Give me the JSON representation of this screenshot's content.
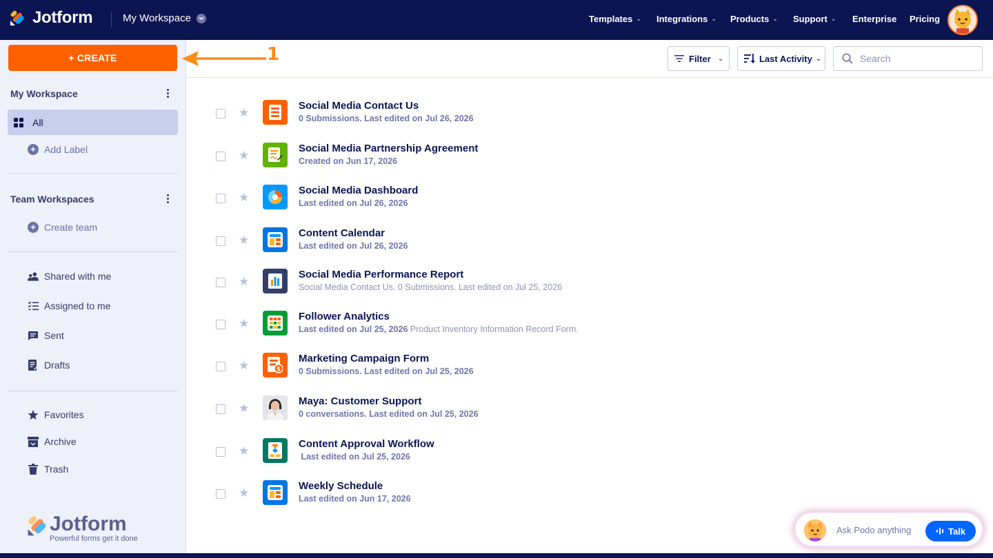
{
  "header": {
    "brand": "Jotform",
    "workspace": "My Workspace",
    "nav": [
      {
        "label": "Templates",
        "has_menu": true
      },
      {
        "label": "Integrations",
        "has_menu": true
      },
      {
        "label": "Products",
        "has_menu": true
      },
      {
        "label": "Support",
        "has_menu": true
      },
      {
        "label": "Enterprise",
        "has_menu": false
      },
      {
        "label": "Pricing",
        "has_menu": false
      }
    ]
  },
  "sidebar": {
    "create_label": "+ CREATE",
    "my_workspace": "My Workspace",
    "all_label": "All",
    "add_label": "Add Label",
    "team_workspaces": "Team Workspaces",
    "create_team": "Create team",
    "links": [
      {
        "label": "Shared with me",
        "icon": "people-icon"
      },
      {
        "label": "Assigned to me",
        "icon": "checklist-icon"
      },
      {
        "label": "Sent",
        "icon": "chat-icon"
      },
      {
        "label": "Drafts",
        "icon": "draft-icon"
      }
    ],
    "links2": [
      {
        "label": "Favorites",
        "icon": "star-icon"
      },
      {
        "label": "Archive",
        "icon": "archive-icon"
      },
      {
        "label": "Trash",
        "icon": "trash-icon"
      }
    ],
    "footer_brand": "Jotform",
    "footer_tagline": "Powerful forms get it done"
  },
  "toolbar": {
    "filter_label": "Filter",
    "sort_label": "Last Activity",
    "search_placeholder": "Search"
  },
  "annotation": {
    "number": "1"
  },
  "items": [
    {
      "title": "Social Media Contact Us",
      "subtitle": "0 Submissions. Last edited on Jul 26, 2026",
      "extra": "",
      "icon": "form-icon",
      "color": "#ff6100"
    },
    {
      "title": "Social Media Partnership Agreement",
      "subtitle": "Created on Jun 17, 2026",
      "extra": "",
      "icon": "sign-icon",
      "color": "#64b200"
    },
    {
      "title": "Social Media Dashboard",
      "subtitle": "Last edited on Jul 26, 2026",
      "extra": "",
      "icon": "report-icon",
      "color": "#0099ff"
    },
    {
      "title": "Content Calendar",
      "subtitle": "Last edited on Jul 26, 2026",
      "extra": "",
      "icon": "app-icon",
      "color": "#0075e3"
    },
    {
      "title": "Social Media Performance Report",
      "subtitle": "",
      "extra": "Social Media Contact Us. 0 Submissions. Last edited on Jul 25, 2026",
      "icon": "bar-report-icon",
      "color": "#344067"
    },
    {
      "title": "Follower Analytics",
      "subtitle": "Last edited on Jul 25, 2026",
      "extra": " Product Inventory Information Record Form.",
      "icon": "table-icon",
      "color": "#049e38"
    },
    {
      "title": "Marketing Campaign Form",
      "subtitle": "0 Submissions. Last edited on Jul 25, 2026",
      "extra": "",
      "icon": "payment-form-icon",
      "color": "#ff6100"
    },
    {
      "title": "Maya: Customer Support",
      "subtitle": "0 conversations. Last edited on Jul 25, 2026",
      "extra": "",
      "icon": "agent-avatar-icon",
      "color": "#d9d9e0"
    },
    {
      "title": "Content Approval Workflow",
      "subtitle": " Last edited on Jul 25, 2026",
      "extra": "",
      "icon": "workflow-icon",
      "color": "#007862"
    },
    {
      "title": "Weekly Schedule",
      "subtitle": "Last edited on Jun 17, 2026",
      "extra": "",
      "icon": "app-icon",
      "color": "#0075e3"
    }
  ],
  "assistant": {
    "prompt": "Ask Podo anything",
    "talk_label": "Talk"
  }
}
